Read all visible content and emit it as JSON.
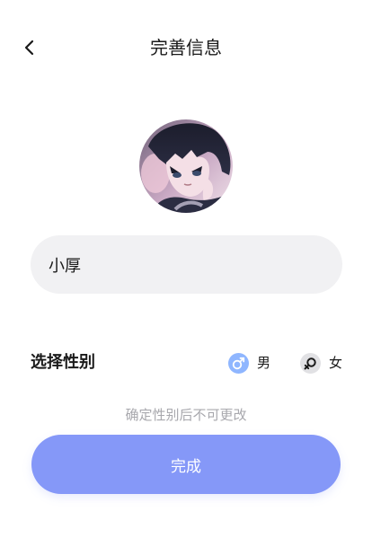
{
  "header": {
    "title": "完善信息",
    "back_icon": "chevron-left-icon"
  },
  "profile": {
    "nickname": "小厚"
  },
  "gender": {
    "label": "选择性别",
    "options": [
      {
        "label": "男",
        "icon": "male-icon",
        "color": "#8fb6ff"
      },
      {
        "label": "女",
        "icon": "female-icon",
        "color": "#e1e1e4"
      }
    ]
  },
  "notice": "确定性别后不可更改",
  "submit_label": "完成",
  "colors": {
    "accent": "#8598f8",
    "field_background": "#f1f1f3",
    "muted_text": "#a8a8ad"
  }
}
